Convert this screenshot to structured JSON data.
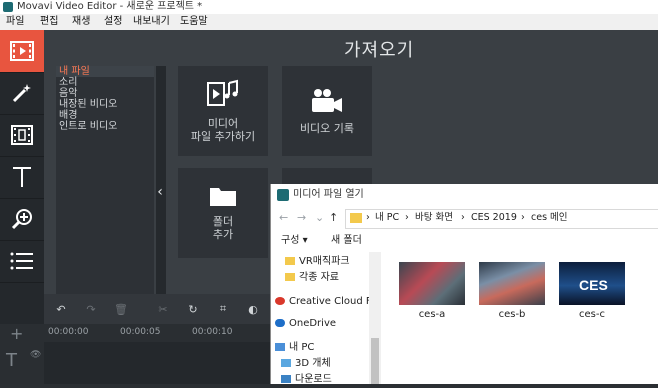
{
  "window": {
    "title": "Movavi Video Editor - 새로운 프로젝트 *"
  },
  "menu": [
    "파일",
    "편집",
    "재생",
    "설정",
    "내보내기",
    "도움말"
  ],
  "sidebar_tools": [
    {
      "name": "import-icon",
      "active": true
    },
    {
      "name": "filters-wand-icon",
      "active": false
    },
    {
      "name": "transitions-icon",
      "active": false
    },
    {
      "name": "titles-icon",
      "active": false
    },
    {
      "name": "zoom-icon",
      "active": false
    },
    {
      "name": "more-list-icon",
      "active": false
    }
  ],
  "import_panel": {
    "header": "가져오기",
    "categories": [
      "내 파일",
      "소리",
      "음악",
      "내장된 비디오",
      "배경",
      "인트로 비디오"
    ],
    "selected_category": "내 파일",
    "tiles": {
      "add_media": "미디어\n파일 추가하기",
      "record_video": "비디오 기록",
      "add_folder": "폴더\n추가"
    }
  },
  "timeline": {
    "ruler": [
      "00:00:00",
      "00:00:05",
      "00:00:10"
    ]
  },
  "file_dialog": {
    "title": "미디어 파일 열기",
    "breadcrumbs": [
      "내 PC",
      "바탕 화면",
      "CES 2019",
      "ces 메인"
    ],
    "organize_label": "구성 ▾",
    "new_folder_label": "새 폴더",
    "nav_items": [
      "VR매직파크",
      "각종 자료",
      "Creative Cloud Fil",
      "OneDrive",
      "내 PC",
      "3D 개체",
      "다운로드"
    ],
    "files": [
      "ces-a",
      "ces-b",
      "ces-c"
    ]
  },
  "colors": {
    "accent": "#e8553f",
    "panel": "#3a3f44",
    "selected_text": "#ff7a55"
  }
}
